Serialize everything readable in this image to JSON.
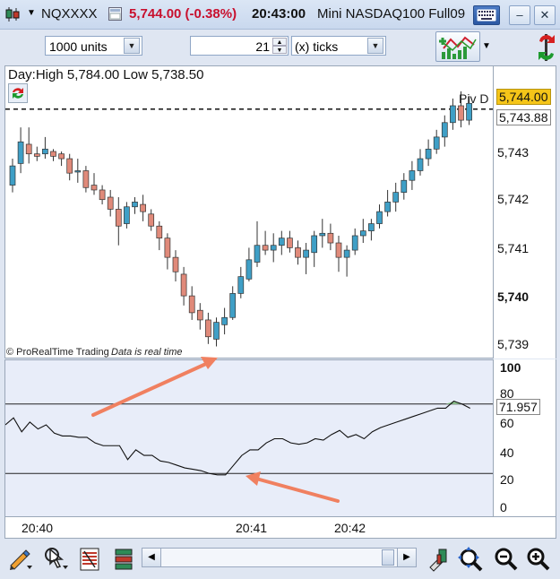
{
  "title_bar": {
    "symbol": "NQXXXX",
    "price_change": "5,744.00 (-0.38%)",
    "time": "20:43:00",
    "instrument": "Mini NASDAQ100 Full09",
    "colors": {
      "change": "#c8102e"
    }
  },
  "toolbar": {
    "units_value": "1000 units",
    "ticks_value": "21",
    "ticks_unit": "(x) ticks"
  },
  "price_pane": {
    "info": "Day:High 5,784.00 Low 5,738.50",
    "copyright": "© ProRealTime Trading",
    "data_note": "Data is real time",
    "pivot_label": "Piv D",
    "last_price_tag": "5,744.00",
    "pivot_price_tag": "5,743.88",
    "y_ticks": [
      "5,743",
      "5,742",
      "5,741",
      "5,740",
      "5,739"
    ]
  },
  "indicator_pane": {
    "value_tag": "71.957",
    "y_ticks": [
      "100",
      "80",
      "60",
      "40",
      "20",
      "0"
    ],
    "levels": [
      75,
      25
    ]
  },
  "time_axis": {
    "ticks": [
      "20:40",
      "20:41",
      "20:42"
    ]
  },
  "chart_data": {
    "type": "candlestick",
    "ylim": [
      5738.8,
      5744.3
    ],
    "candles": [
      [
        5742.3,
        5742.85,
        5742.15,
        5742.7
      ],
      [
        5742.75,
        5743.5,
        5742.55,
        5743.2
      ],
      [
        5743.15,
        5743.5,
        5742.75,
        5742.95
      ],
      [
        5742.95,
        5743.1,
        5742.8,
        5742.9
      ],
      [
        5742.95,
        5743.3,
        5742.85,
        5743.05
      ],
      [
        5743.0,
        5743.05,
        5742.8,
        5742.9
      ],
      [
        5742.95,
        5743.0,
        5742.7,
        5742.85
      ],
      [
        5742.85,
        5742.95,
        5742.4,
        5742.55
      ],
      [
        5742.6,
        5742.85,
        5742.35,
        5742.6
      ],
      [
        5742.6,
        5742.7,
        5742.15,
        5742.25
      ],
      [
        5742.3,
        5742.55,
        5742.1,
        5742.2
      ],
      [
        5742.2,
        5742.3,
        5741.9,
        5742.0
      ],
      [
        5742.05,
        5742.2,
        5741.65,
        5741.8
      ],
      [
        5741.8,
        5742.05,
        5741.05,
        5741.45
      ],
      [
        5741.5,
        5741.95,
        5741.4,
        5741.85
      ],
      [
        5741.85,
        5742.05,
        5741.7,
        5741.95
      ],
      [
        5741.9,
        5742.1,
        5741.55,
        5741.75
      ],
      [
        5741.7,
        5741.8,
        5741.35,
        5741.45
      ],
      [
        5741.45,
        5741.55,
        5740.95,
        5741.2
      ],
      [
        5741.2,
        5741.3,
        5740.55,
        5740.8
      ],
      [
        5740.8,
        5740.95,
        5740.3,
        5740.5
      ],
      [
        5740.45,
        5740.6,
        5739.8,
        5740.0
      ],
      [
        5740.0,
        5740.2,
        5739.5,
        5739.65
      ],
      [
        5739.7,
        5739.85,
        5739.3,
        5739.5
      ],
      [
        5739.5,
        5739.65,
        5739.0,
        5739.15
      ],
      [
        5739.1,
        5739.55,
        5738.95,
        5739.45
      ],
      [
        5739.4,
        5739.75,
        5739.2,
        5739.55
      ],
      [
        5739.55,
        5740.2,
        5739.5,
        5740.05
      ],
      [
        5740.05,
        5740.6,
        5739.95,
        5740.4
      ],
      [
        5740.35,
        5741.0,
        5740.3,
        5740.75
      ],
      [
        5740.7,
        5741.55,
        5740.6,
        5741.05
      ],
      [
        5741.05,
        5741.35,
        5740.85,
        5740.95
      ],
      [
        5740.95,
        5741.3,
        5740.7,
        5741.05
      ],
      [
        5741.05,
        5741.35,
        5740.85,
        5741.2
      ],
      [
        5741.2,
        5741.35,
        5740.9,
        5741.0
      ],
      [
        5741.0,
        5741.15,
        5740.65,
        5740.8
      ],
      [
        5740.8,
        5741.1,
        5740.45,
        5740.95
      ],
      [
        5740.9,
        5741.35,
        5740.6,
        5741.25
      ],
      [
        5741.25,
        5741.6,
        5741.0,
        5741.3
      ],
      [
        5741.3,
        5741.5,
        5740.95,
        5741.1
      ],
      [
        5741.1,
        5741.25,
        5740.5,
        5740.8
      ],
      [
        5740.8,
        5741.05,
        5740.4,
        5740.95
      ],
      [
        5740.95,
        5741.4,
        5740.85,
        5741.25
      ],
      [
        5741.25,
        5741.6,
        5741.1,
        5741.35
      ],
      [
        5741.35,
        5741.6,
        5741.15,
        5741.5
      ],
      [
        5741.5,
        5741.9,
        5741.4,
        5741.75
      ],
      [
        5741.75,
        5742.2,
        5741.65,
        5741.95
      ],
      [
        5741.95,
        5742.35,
        5741.75,
        5742.15
      ],
      [
        5742.15,
        5742.55,
        5742.0,
        5742.4
      ],
      [
        5742.4,
        5742.8,
        5742.2,
        5742.6
      ],
      [
        5742.6,
        5743.05,
        5742.5,
        5742.85
      ],
      [
        5742.85,
        5743.25,
        5742.7,
        5743.05
      ],
      [
        5743.05,
        5743.45,
        5742.95,
        5743.3
      ],
      [
        5743.3,
        5743.75,
        5743.1,
        5743.6
      ],
      [
        5743.6,
        5744.1,
        5743.45,
        5743.95
      ],
      [
        5743.95,
        5744.25,
        5743.5,
        5743.65
      ],
      [
        5743.65,
        5744.15,
        5743.55,
        5744.0
      ]
    ],
    "indicator": [
      60,
      65,
      55,
      62,
      57,
      60,
      54,
      52,
      52,
      51,
      51,
      47,
      45,
      45,
      45,
      35,
      42,
      38,
      38,
      34,
      33,
      31,
      29,
      28,
      27,
      25,
      24,
      24,
      31,
      38,
      42,
      42,
      47,
      50,
      50,
      47,
      46,
      47,
      50,
      49,
      53,
      56,
      51,
      53,
      50,
      55,
      58,
      60,
      62,
      64,
      66,
      68,
      70,
      72,
      72,
      77,
      75,
      71.957
    ]
  }
}
